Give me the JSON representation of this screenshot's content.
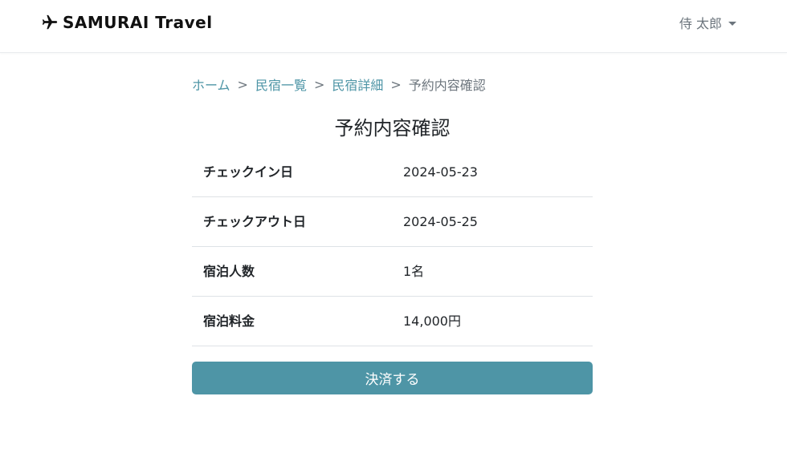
{
  "header": {
    "brand_name": "SAMURAI Travel",
    "brand_icon": "airplane-icon",
    "user_name": "侍 太郎"
  },
  "breadcrumb": {
    "items": [
      "ホーム",
      "民宿一覧",
      "民宿詳細"
    ],
    "separator": ">",
    "current": "予約内容確認"
  },
  "page": {
    "title": "予約内容確認"
  },
  "reservation": {
    "rows": [
      {
        "label": "チェックイン日",
        "value": "2024-05-23"
      },
      {
        "label": "チェックアウト日",
        "value": "2024-05-25"
      },
      {
        "label": "宿泊人数",
        "value": "1名"
      },
      {
        "label": "宿泊料金",
        "value": "14,000円"
      }
    ]
  },
  "actions": {
    "pay_label": "決済する"
  },
  "colors": {
    "accent": "#4e95a6",
    "text": "#212529",
    "muted": "#6c757d",
    "divider": "#dee2e6"
  }
}
